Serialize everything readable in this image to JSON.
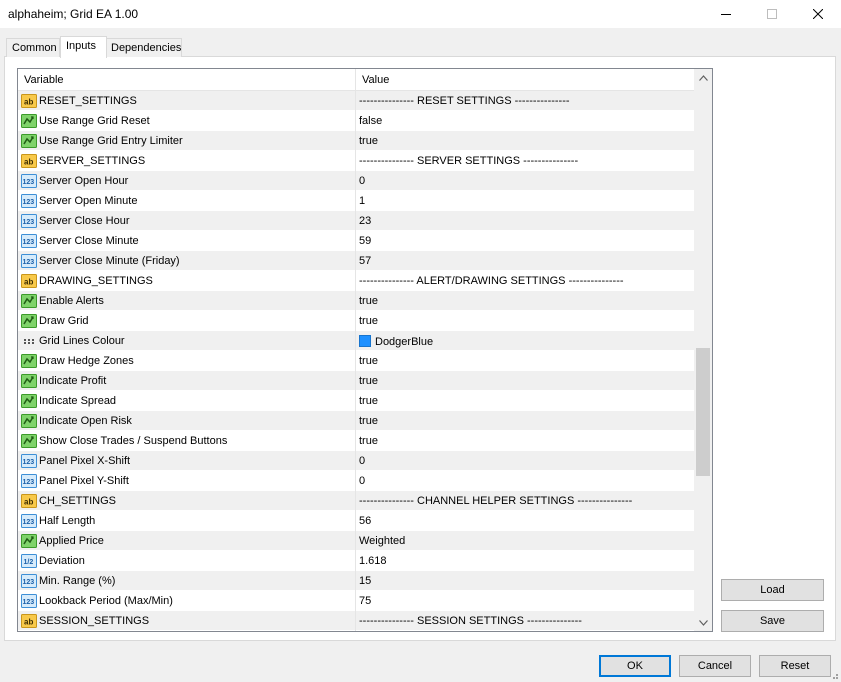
{
  "window": {
    "title": "alphaheim; Grid EA 1.00"
  },
  "tabs": [
    {
      "label": "Common"
    },
    {
      "label": "Inputs"
    },
    {
      "label": "Dependencies"
    }
  ],
  "grid": {
    "columns": {
      "variable": "Variable",
      "value": "Value"
    },
    "rows": [
      {
        "icon": "string-icon",
        "variable": "RESET_SETTINGS",
        "value": "--------------- RESET SETTINGS ---------------"
      },
      {
        "icon": "bool-icon",
        "variable": "Use Range Grid Reset",
        "value": "false"
      },
      {
        "icon": "bool-icon",
        "variable": "Use Range Grid Entry Limiter",
        "value": "true"
      },
      {
        "icon": "string-icon",
        "variable": "SERVER_SETTINGS",
        "value": "--------------- SERVER SETTINGS ---------------"
      },
      {
        "icon": "int-icon",
        "variable": "Server Open Hour",
        "value": "0"
      },
      {
        "icon": "int-icon",
        "variable": "Server Open Minute",
        "value": "1"
      },
      {
        "icon": "int-icon",
        "variable": "Server Close Hour",
        "value": "23"
      },
      {
        "icon": "int-icon",
        "variable": "Server Close Minute",
        "value": "59"
      },
      {
        "icon": "int-icon",
        "variable": "Server Close Minute (Friday)",
        "value": "57"
      },
      {
        "icon": "string-icon",
        "variable": "DRAWING_SETTINGS",
        "value": "--------------- ALERT/DRAWING SETTINGS ---------------"
      },
      {
        "icon": "bool-icon",
        "variable": "Enable Alerts",
        "value": "true"
      },
      {
        "icon": "bool-icon",
        "variable": "Draw Grid",
        "value": "true"
      },
      {
        "icon": "color-icon",
        "variable": "Grid Lines Colour",
        "value": "DodgerBlue",
        "swatch": "#1e90ff"
      },
      {
        "icon": "bool-icon",
        "variable": "Draw Hedge Zones",
        "value": "true"
      },
      {
        "icon": "bool-icon",
        "variable": "Indicate Profit",
        "value": "true"
      },
      {
        "icon": "bool-icon",
        "variable": "Indicate Spread",
        "value": "true"
      },
      {
        "icon": "bool-icon",
        "variable": "Indicate Open Risk",
        "value": "true"
      },
      {
        "icon": "bool-icon",
        "variable": "Show Close Trades / Suspend Buttons",
        "value": "true"
      },
      {
        "icon": "int-icon",
        "variable": "Panel Pixel X-Shift",
        "value": "0"
      },
      {
        "icon": "int-icon",
        "variable": "Panel Pixel Y-Shift",
        "value": "0"
      },
      {
        "icon": "string-icon",
        "variable": "CH_SETTINGS",
        "value": "--------------- CHANNEL HELPER SETTINGS ---------------"
      },
      {
        "icon": "int-icon",
        "variable": "Half Length",
        "value": "56"
      },
      {
        "icon": "enum-icon",
        "variable": "Applied Price",
        "value": "Weighted"
      },
      {
        "icon": "double-icon",
        "variable": "Deviation",
        "value": "1.618"
      },
      {
        "icon": "int-icon",
        "variable": "Min. Range (%)",
        "value": "15"
      },
      {
        "icon": "int-icon",
        "variable": "Lookback Period (Max/Min)",
        "value": "75"
      },
      {
        "icon": "string-icon",
        "variable": "SESSION_SETTINGS",
        "value": "--------------- SESSION SETTINGS ---------------"
      }
    ]
  },
  "side_buttons": {
    "load": "Load",
    "save": "Save"
  },
  "footer_buttons": {
    "ok": "OK",
    "cancel": "Cancel",
    "reset": "Reset"
  },
  "colors": {
    "accent": "#0078d7",
    "row_alt": "#f0f0f0"
  }
}
